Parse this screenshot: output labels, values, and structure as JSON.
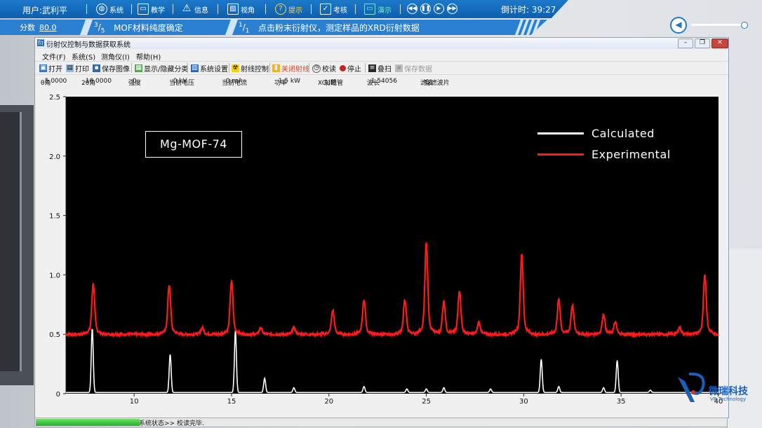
{
  "topbar": {
    "user": "用户:武利平",
    "tools": [
      {
        "label": "系统",
        "icon": "globe-icon"
      },
      {
        "label": "教学",
        "icon": "teaching-icon"
      },
      {
        "label": "信息",
        "icon": "warning-icon"
      },
      {
        "label": "视角",
        "icon": "view-icon"
      },
      {
        "label": "提示",
        "icon": "question-icon"
      },
      {
        "label": "考核",
        "icon": "exam-icon"
      },
      {
        "label": "演示",
        "icon": "demo-icon"
      }
    ],
    "countdown": "倒计时: 39:27"
  },
  "steps": {
    "score_label": "分数",
    "score_value": "80.0",
    "step1_num": "3",
    "step1_den": "5",
    "step1_title": "MOF材料纯度确定",
    "step2_num": "1",
    "step2_den": "1",
    "step2_title": "点击粉末衍射仪，测定样品的XRD衍射数据"
  },
  "window": {
    "title": "衍射仪控制与数据获取系统",
    "menu": [
      "文件(F)",
      "系统(S)",
      "测角仪(I)",
      "帮助(H)"
    ],
    "toolbar": {
      "open": "打开",
      "print": "打印",
      "save_image": "保存图像",
      "toggle_class": "显示/隐藏分类",
      "settings": "系统设置",
      "ray_control": "射线控制",
      "close_ray": "关闭射线",
      "calibrate": "校读",
      "stop": "停止",
      "stack": "叠扫",
      "save_data": "保存数据"
    },
    "status": {
      "theta_label": "θ角",
      "theta": "5.0000",
      "twotheta_label": "2θ角",
      "twotheta": "10.0000",
      "intensity_label": "强度",
      "intensity": "0",
      "voltage_label": "当前电压",
      "voltage": "0 kV",
      "current_label": "当前电流",
      "current": "0 mA",
      "power_label": "功率",
      "power": "1.5 kW",
      "tube_label": "X 射线管",
      "tube": "Cu靶",
      "wavelength_label": "波长",
      "wavelength": "1.54056",
      "filter_label": "滤波",
      "filter": "有滤波片"
    }
  },
  "progress": {
    "status_text": "系统状态>> 校读完毕.",
    "fraction": 0.15
  },
  "brand": {
    "name": "微瑞科技",
    "sub": "VR Technology"
  },
  "colors": {
    "calculated": "#ffffff",
    "experimental": "#ff1a1a",
    "topbar": "#1670c2"
  },
  "chart_data": {
    "type": "line",
    "sample_label": "Mg-MOF-74",
    "xlim": [
      6.5,
      40
    ],
    "ylim": [
      0,
      2.5
    ],
    "xticks": [
      10,
      15,
      20,
      25,
      30,
      35,
      40
    ],
    "yticks": [
      0,
      0.5,
      1.0,
      1.5,
      2.0,
      2.5
    ],
    "ytick_labels": [
      "0",
      "0.5",
      "1.0",
      "1.5",
      "2.0",
      "2.5"
    ],
    "series": [
      {
        "name": "Calculated",
        "color": "#ffffff",
        "baseline": 0.01,
        "peaks": [
          [
            7.85,
            0.54
          ],
          [
            11.85,
            0.32
          ],
          [
            15.2,
            0.52
          ],
          [
            16.7,
            0.12
          ],
          [
            18.2,
            0.04
          ],
          [
            21.8,
            0.05
          ],
          [
            24.0,
            0.03
          ],
          [
            25.0,
            0.03
          ],
          [
            25.9,
            0.04
          ],
          [
            28.3,
            0.03
          ],
          [
            30.9,
            0.28
          ],
          [
            31.8,
            0.05
          ],
          [
            34.1,
            0.04
          ],
          [
            34.8,
            0.27
          ],
          [
            36.5,
            0.02
          ]
        ]
      },
      {
        "name": "Experimental",
        "color": "#ff1a1a",
        "baseline": 0.5,
        "peaks": [
          [
            7.9,
            0.38
          ],
          [
            11.8,
            0.37
          ],
          [
            13.5,
            0.05
          ],
          [
            15.0,
            0.4
          ],
          [
            16.5,
            0.05
          ],
          [
            18.2,
            0.05
          ],
          [
            20.2,
            0.18
          ],
          [
            21.8,
            0.26
          ],
          [
            23.9,
            0.26
          ],
          [
            25.0,
            0.69
          ],
          [
            25.9,
            0.25
          ],
          [
            26.7,
            0.33
          ],
          [
            27.7,
            0.09
          ],
          [
            29.9,
            0.6
          ],
          [
            31.8,
            0.26
          ],
          [
            32.5,
            0.22
          ],
          [
            34.1,
            0.15
          ],
          [
            34.7,
            0.09
          ],
          [
            38.0,
            0.05
          ],
          [
            39.3,
            0.45
          ]
        ]
      }
    ]
  }
}
